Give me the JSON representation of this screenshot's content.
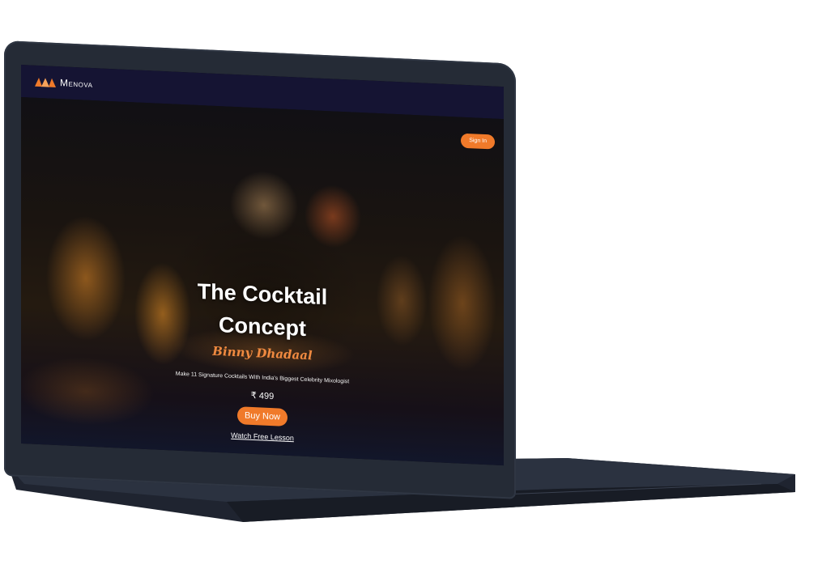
{
  "navbar": {
    "brand": "Menova"
  },
  "header": {
    "signin_label": "Sign In"
  },
  "hero": {
    "title_line1": "The Cocktail",
    "title_line2": "Concept",
    "author": "Binny Dhadaal",
    "tagline": "Make 11 Signature Cocktails With India's Biggest Celebrity Mixologist",
    "price": "₹ 499",
    "buy_label": "Buy Now",
    "watch_label": "Watch Free Lesson"
  },
  "colors": {
    "accent": "#f07a2a",
    "navbar_bg": "#151433",
    "laptop_body": "#252b36"
  }
}
